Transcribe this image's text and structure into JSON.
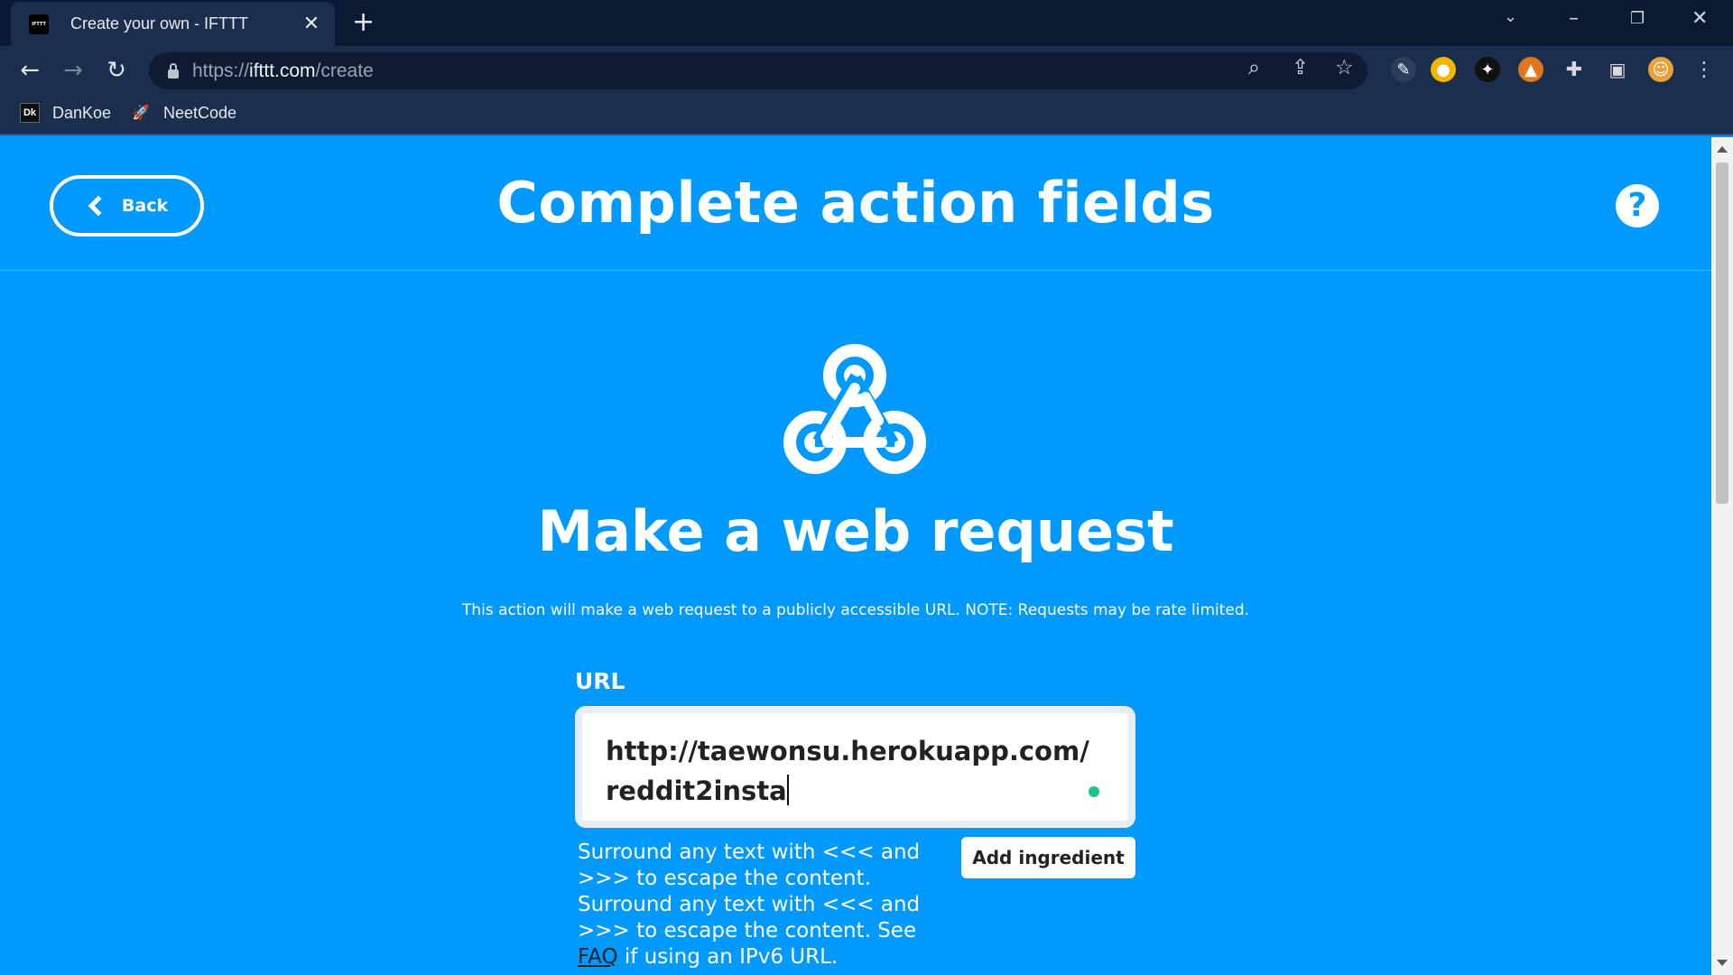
{
  "browser": {
    "tab_title": "Create your own - IFTTT",
    "tab_favicon_text": "IFTTT",
    "url_scheme": "https://",
    "url_host": "ifttt.com",
    "url_path": "/create",
    "bookmarks": [
      {
        "label": "DanKoe",
        "icon": "dankoe-icon"
      },
      {
        "label": "NeetCode",
        "icon": "neetcode-rocket-icon"
      }
    ]
  },
  "header": {
    "back_label": "Back",
    "title": "Complete action fields",
    "help_symbol": "?"
  },
  "service": {
    "icon": "webhook-icon",
    "title": "Make a web request",
    "description": "This action will make a web request to a publicly accessible URL. NOTE: Requests may be rate limited."
  },
  "url_field": {
    "label": "URL",
    "value": "http://taewonsu.herokuapp.com/reddit2insta",
    "add_ingredient_label": "Add ingredient",
    "helper_text": "Surround any text with <<< and >>> to escape the content. Surround any text with <<< and >>> to escape the content. See",
    "faq_link": "FAQ",
    "helper_suffix": " if using an IPv6 URL."
  },
  "colors": {
    "page_bg": "#0099ff",
    "chrome_bg": "#1b2e4e",
    "valid_dot": "#1fbf8f"
  }
}
